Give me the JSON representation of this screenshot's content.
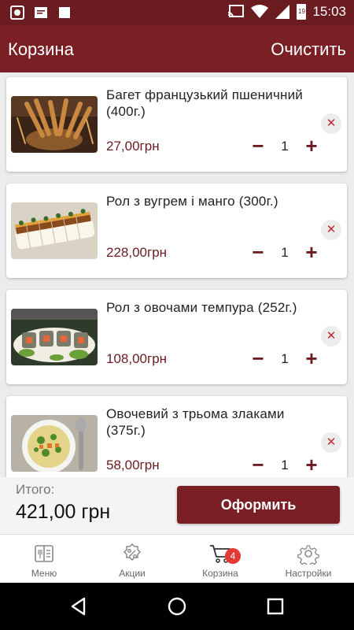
{
  "status_bar": {
    "time": "15:03",
    "battery": "19",
    "icons": [
      "screenshot-icon",
      "message-icon",
      "stop-icon",
      "cast-icon",
      "wifi-icon",
      "signal-icon",
      "battery-icon"
    ]
  },
  "header": {
    "title": "Корзина",
    "clear_label": "Очистить"
  },
  "cart": {
    "items": [
      {
        "name": "Багет французький пшеничний (400г.)",
        "price": "27,00грн",
        "quantity": "1",
        "image": "bread-baskets"
      },
      {
        "name": "Рол з вугрем і манго (300г.)",
        "price": "228,00грн",
        "quantity": "1",
        "image": "eel-mango-roll"
      },
      {
        "name": "Рол з овочами темпура (252г.)",
        "price": "108,00грн",
        "quantity": "1",
        "image": "tempura-vegetable-roll"
      },
      {
        "name": "Овочевий з трьома злаками (375г.)",
        "price": "58,00грн",
        "quantity": "1",
        "image": "vegetable-soup"
      }
    ],
    "remove_symbol": "✕",
    "minus_symbol": "−",
    "plus_symbol": "+"
  },
  "summary": {
    "total_label": "Итого:",
    "total_value": "421,00 грн",
    "checkout_label": "Оформить"
  },
  "bottom_nav": {
    "items": [
      {
        "label": "Меню",
        "icon": "menu-book-icon"
      },
      {
        "label": "Акции",
        "icon": "discount-icon"
      },
      {
        "label": "Корзина",
        "icon": "cart-icon",
        "badge": "4",
        "active": true
      },
      {
        "label": "Настройки",
        "icon": "gear-icon"
      }
    ]
  },
  "colors": {
    "primary": "#7a1f24",
    "status_bar": "#6b1c20",
    "price": "#6b1c20",
    "badge": "#e53935",
    "remove": "#c0282f"
  }
}
